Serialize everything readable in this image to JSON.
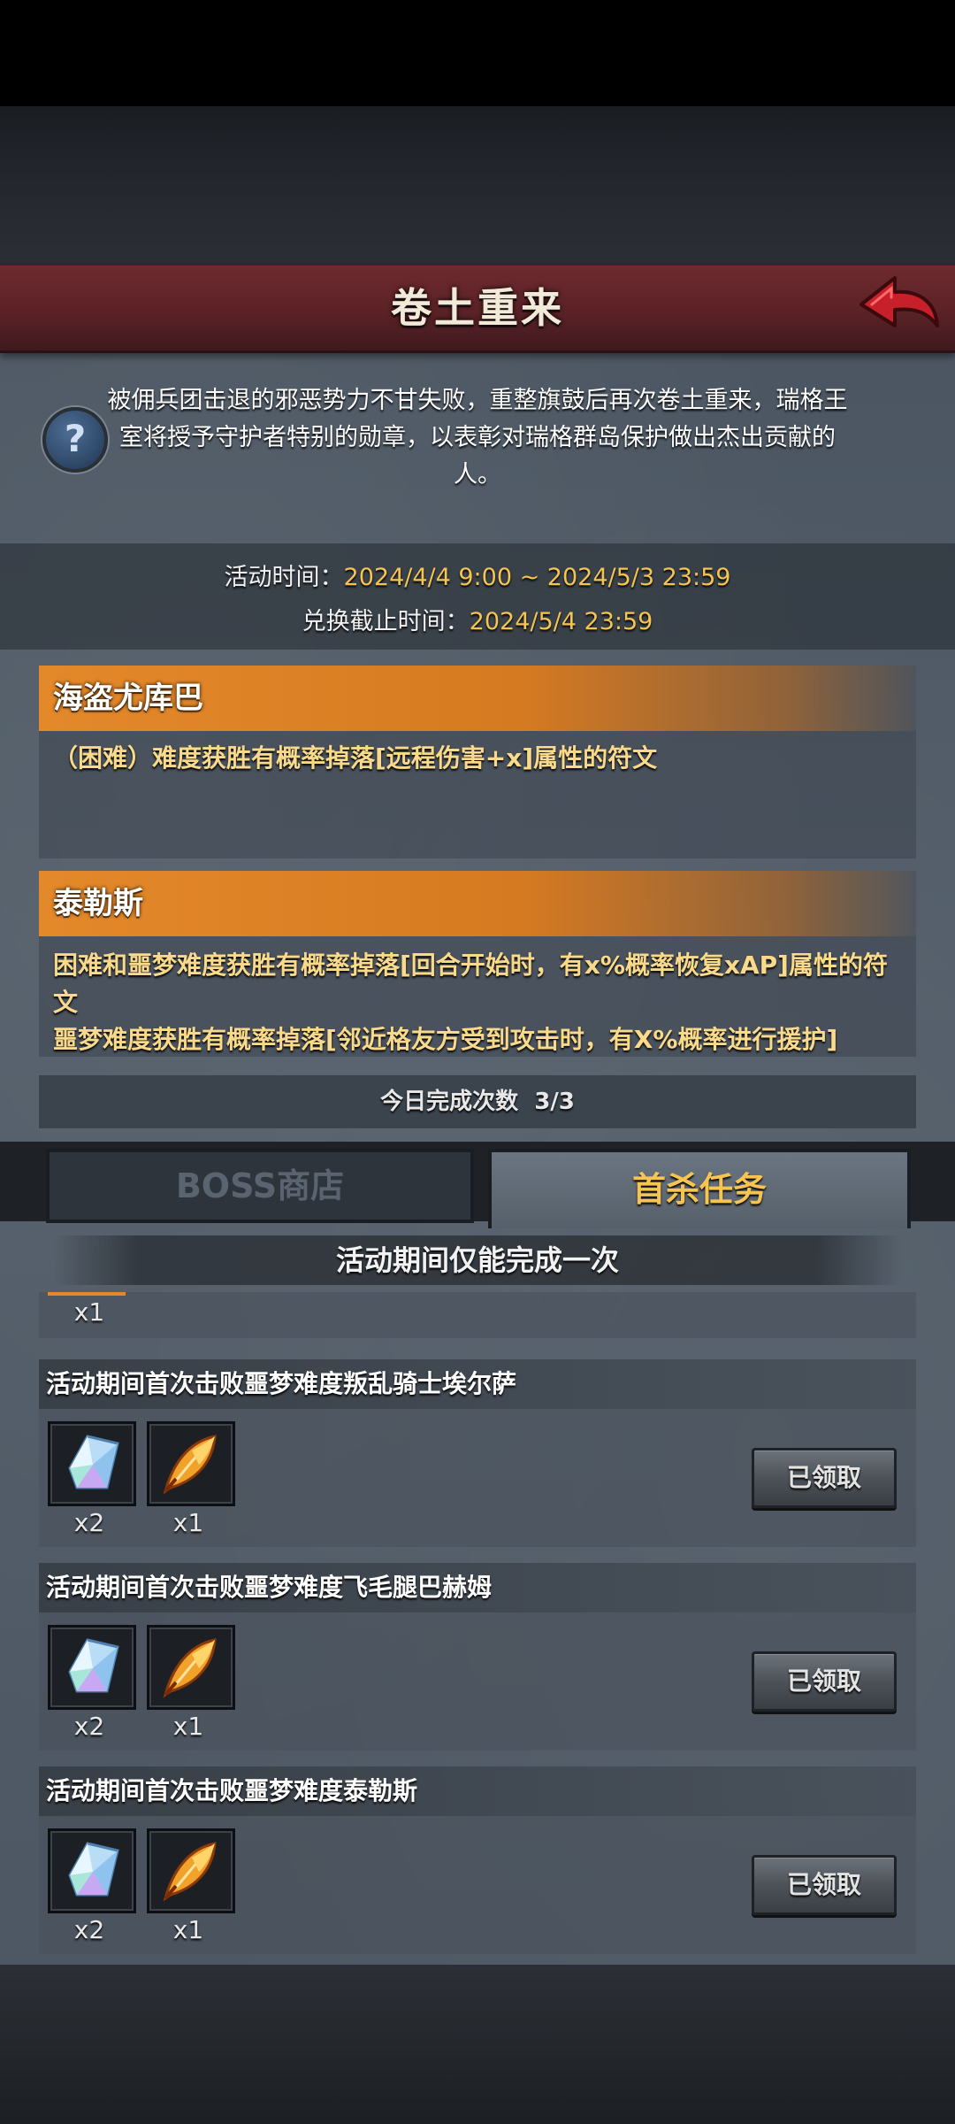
{
  "header": {
    "title": "卷土重来"
  },
  "intro": {
    "text": "被佣兵团击退的邪恶势力不甘失败，重整旗鼓后再次卷土重来，瑞格王室将授予守护者特别的勋章，以表彰对瑞格群岛保护做出杰出贡献的人。"
  },
  "event_time": {
    "label": "活动时间：",
    "value": "2024/4/4 9:00 ~ 2024/5/3 23:59",
    "exchange_label": "兑换截止时间：",
    "exchange_value": "2024/5/4 23:59"
  },
  "bosses": [
    {
      "name": "海盗尤库巴",
      "desc": "（困难）难度获胜有概率掉落[远程伤害+x]属性的符文"
    },
    {
      "name": "泰勒斯",
      "desc1": "困难和噩梦难度获胜有概率掉落[回合开始时，有x%概率恢复xAP]属性的符文",
      "desc2": "噩梦难度获胜有概率掉落[邻近格友方受到攻击时，有X%概率进行援护]"
    }
  ],
  "today": {
    "label": "今日完成次数",
    "value": "3/3"
  },
  "tabs": {
    "boss_shop": "BOSS商店",
    "first_kill": "首杀任务"
  },
  "banner": "活动期间仅能完成一次",
  "partial_count": "x1",
  "tasks": [
    {
      "title": "活动期间首次击败噩梦难度叛乱骑士埃尔萨",
      "rewards": [
        {
          "icon": "crystal-icon",
          "count": "x2"
        },
        {
          "icon": "feather-icon",
          "count": "x1"
        }
      ],
      "button": "已领取"
    },
    {
      "title": "活动期间首次击败噩梦难度飞毛腿巴赫姆",
      "rewards": [
        {
          "icon": "crystal-icon",
          "count": "x2"
        },
        {
          "icon": "feather-icon",
          "count": "x1"
        }
      ],
      "button": "已领取"
    },
    {
      "title": "活动期间首次击败噩梦难度泰勒斯",
      "rewards": [
        {
          "icon": "crystal-icon",
          "count": "x2"
        },
        {
          "icon": "feather-icon",
          "count": "x1"
        }
      ],
      "button": "已领取"
    }
  ],
  "colors": {
    "title_bar": "#5b2226",
    "accent_gold": "#f5c451",
    "boss_orange": "#e4892a",
    "back_arrow": "#c8202a"
  }
}
